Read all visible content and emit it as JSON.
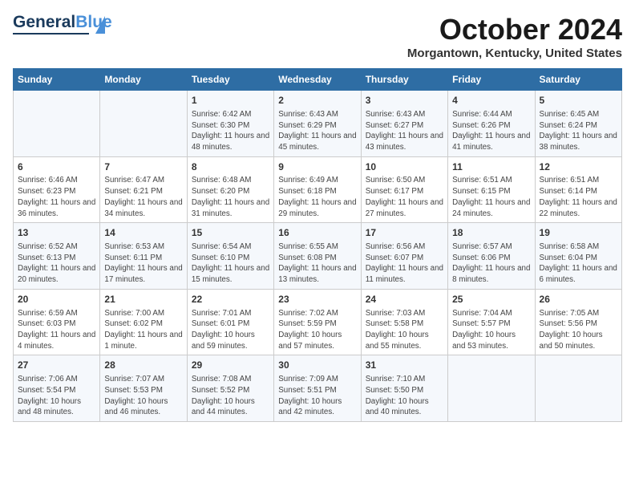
{
  "header": {
    "logo_general": "General",
    "logo_blue": "Blue",
    "month": "October 2024",
    "location": "Morgantown, Kentucky, United States"
  },
  "days_of_week": [
    "Sunday",
    "Monday",
    "Tuesday",
    "Wednesday",
    "Thursday",
    "Friday",
    "Saturday"
  ],
  "weeks": [
    [
      {
        "day": "",
        "info": ""
      },
      {
        "day": "",
        "info": ""
      },
      {
        "day": "1",
        "info": "Sunrise: 6:42 AM\nSunset: 6:30 PM\nDaylight: 11 hours and 48 minutes."
      },
      {
        "day": "2",
        "info": "Sunrise: 6:43 AM\nSunset: 6:29 PM\nDaylight: 11 hours and 45 minutes."
      },
      {
        "day": "3",
        "info": "Sunrise: 6:43 AM\nSunset: 6:27 PM\nDaylight: 11 hours and 43 minutes."
      },
      {
        "day": "4",
        "info": "Sunrise: 6:44 AM\nSunset: 6:26 PM\nDaylight: 11 hours and 41 minutes."
      },
      {
        "day": "5",
        "info": "Sunrise: 6:45 AM\nSunset: 6:24 PM\nDaylight: 11 hours and 38 minutes."
      }
    ],
    [
      {
        "day": "6",
        "info": "Sunrise: 6:46 AM\nSunset: 6:23 PM\nDaylight: 11 hours and 36 minutes."
      },
      {
        "day": "7",
        "info": "Sunrise: 6:47 AM\nSunset: 6:21 PM\nDaylight: 11 hours and 34 minutes."
      },
      {
        "day": "8",
        "info": "Sunrise: 6:48 AM\nSunset: 6:20 PM\nDaylight: 11 hours and 31 minutes."
      },
      {
        "day": "9",
        "info": "Sunrise: 6:49 AM\nSunset: 6:18 PM\nDaylight: 11 hours and 29 minutes."
      },
      {
        "day": "10",
        "info": "Sunrise: 6:50 AM\nSunset: 6:17 PM\nDaylight: 11 hours and 27 minutes."
      },
      {
        "day": "11",
        "info": "Sunrise: 6:51 AM\nSunset: 6:15 PM\nDaylight: 11 hours and 24 minutes."
      },
      {
        "day": "12",
        "info": "Sunrise: 6:51 AM\nSunset: 6:14 PM\nDaylight: 11 hours and 22 minutes."
      }
    ],
    [
      {
        "day": "13",
        "info": "Sunrise: 6:52 AM\nSunset: 6:13 PM\nDaylight: 11 hours and 20 minutes."
      },
      {
        "day": "14",
        "info": "Sunrise: 6:53 AM\nSunset: 6:11 PM\nDaylight: 11 hours and 17 minutes."
      },
      {
        "day": "15",
        "info": "Sunrise: 6:54 AM\nSunset: 6:10 PM\nDaylight: 11 hours and 15 minutes."
      },
      {
        "day": "16",
        "info": "Sunrise: 6:55 AM\nSunset: 6:08 PM\nDaylight: 11 hours and 13 minutes."
      },
      {
        "day": "17",
        "info": "Sunrise: 6:56 AM\nSunset: 6:07 PM\nDaylight: 11 hours and 11 minutes."
      },
      {
        "day": "18",
        "info": "Sunrise: 6:57 AM\nSunset: 6:06 PM\nDaylight: 11 hours and 8 minutes."
      },
      {
        "day": "19",
        "info": "Sunrise: 6:58 AM\nSunset: 6:04 PM\nDaylight: 11 hours and 6 minutes."
      }
    ],
    [
      {
        "day": "20",
        "info": "Sunrise: 6:59 AM\nSunset: 6:03 PM\nDaylight: 11 hours and 4 minutes."
      },
      {
        "day": "21",
        "info": "Sunrise: 7:00 AM\nSunset: 6:02 PM\nDaylight: 11 hours and 1 minute."
      },
      {
        "day": "22",
        "info": "Sunrise: 7:01 AM\nSunset: 6:01 PM\nDaylight: 10 hours and 59 minutes."
      },
      {
        "day": "23",
        "info": "Sunrise: 7:02 AM\nSunset: 5:59 PM\nDaylight: 10 hours and 57 minutes."
      },
      {
        "day": "24",
        "info": "Sunrise: 7:03 AM\nSunset: 5:58 PM\nDaylight: 10 hours and 55 minutes."
      },
      {
        "day": "25",
        "info": "Sunrise: 7:04 AM\nSunset: 5:57 PM\nDaylight: 10 hours and 53 minutes."
      },
      {
        "day": "26",
        "info": "Sunrise: 7:05 AM\nSunset: 5:56 PM\nDaylight: 10 hours and 50 minutes."
      }
    ],
    [
      {
        "day": "27",
        "info": "Sunrise: 7:06 AM\nSunset: 5:54 PM\nDaylight: 10 hours and 48 minutes."
      },
      {
        "day": "28",
        "info": "Sunrise: 7:07 AM\nSunset: 5:53 PM\nDaylight: 10 hours and 46 minutes."
      },
      {
        "day": "29",
        "info": "Sunrise: 7:08 AM\nSunset: 5:52 PM\nDaylight: 10 hours and 44 minutes."
      },
      {
        "day": "30",
        "info": "Sunrise: 7:09 AM\nSunset: 5:51 PM\nDaylight: 10 hours and 42 minutes."
      },
      {
        "day": "31",
        "info": "Sunrise: 7:10 AM\nSunset: 5:50 PM\nDaylight: 10 hours and 40 minutes."
      },
      {
        "day": "",
        "info": ""
      },
      {
        "day": "",
        "info": ""
      }
    ]
  ]
}
